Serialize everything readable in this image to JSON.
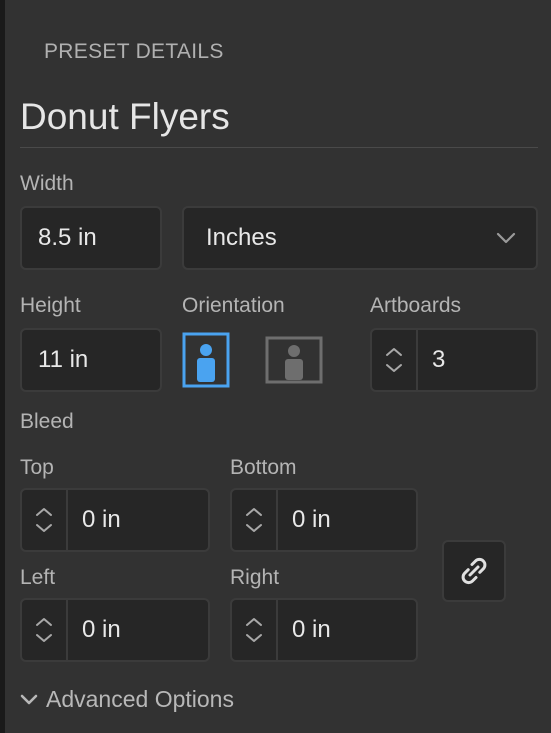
{
  "panel": {
    "section_title": "PRESET DETAILS",
    "preset_name": "Donut Flyers"
  },
  "width": {
    "label": "Width",
    "value": "8.5 in"
  },
  "units": {
    "selected": "Inches",
    "icon": "chevron-down-icon"
  },
  "height": {
    "label": "Height",
    "value": "11 in"
  },
  "orientation": {
    "label": "Orientation",
    "options": [
      {
        "name": "portrait",
        "active": true,
        "color": "#4aa3f0"
      },
      {
        "name": "landscape",
        "active": false,
        "color": "#6e6e6e"
      }
    ]
  },
  "artboards": {
    "label": "Artboards",
    "value": "3"
  },
  "bleed": {
    "label": "Bleed",
    "top": {
      "label": "Top",
      "value": "0 in"
    },
    "bottom": {
      "label": "Bottom",
      "value": "0 in"
    },
    "left": {
      "label": "Left",
      "value": "0 in"
    },
    "right": {
      "label": "Right",
      "value": "0 in"
    },
    "link_icon": "link-icon"
  },
  "advanced": {
    "label": "Advanced Options",
    "icon": "chevron-down-icon"
  }
}
